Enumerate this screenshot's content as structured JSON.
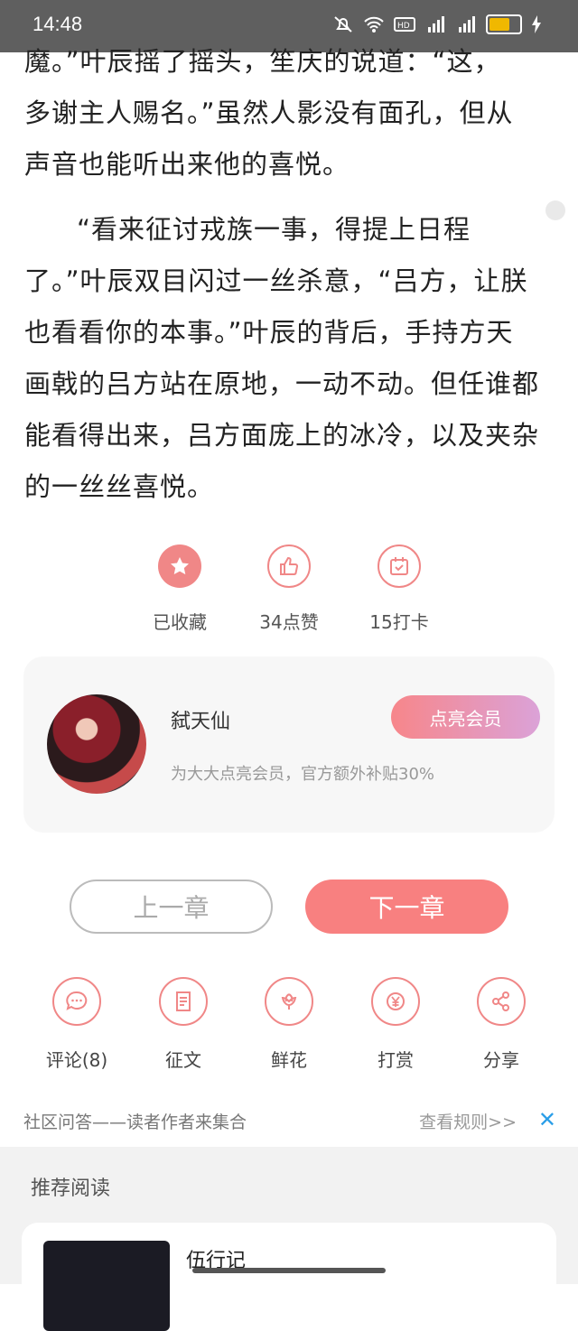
{
  "status_bar": {
    "time": "14:48",
    "battery_color": "#f0b800"
  },
  "content": {
    "para1_lines": [
      "魔。”叶辰摇了摇头，笙庆的说道：“这，",
      "多谢主人赐名。”虽然人影没有面孔，但从",
      "声音也能听出来他的喜悦。"
    ],
    "para2": "“看来征讨戎族一事，得提上日程了。”叶辰双目闪过一丝杀意，“吕方，让朕也看看你的本事。”叶辰的背后，手持方天画戟的吕方站在原地，一动不动。但任谁都能看得出来，吕方面庞上的冰冷，以及夹杂的一丝丝喜悦。"
  },
  "actions": {
    "favorite_label": "已收藏",
    "like_label": "34点赞",
    "checkin_label": "15打卡"
  },
  "member": {
    "username": "弑天仙",
    "tip": "为大大点亮会员，官方额外补贴30%",
    "vip_button": "点亮会员"
  },
  "nav": {
    "prev": "上一章",
    "next": "下一章"
  },
  "tools": {
    "comment": "评论(8)",
    "essay": "征文",
    "flower": "鲜花",
    "reward": "打赏",
    "share": "分享"
  },
  "community": {
    "text": "社区问答——读者作者来集合",
    "rules": "查看规则>>",
    "close": "✕"
  },
  "recommend": {
    "title": "推荐阅读",
    "book_name": "伍行记"
  },
  "colors": {
    "accent": "#f08787",
    "next_button": "#f88080",
    "link_blue": "#2a9ee8"
  }
}
